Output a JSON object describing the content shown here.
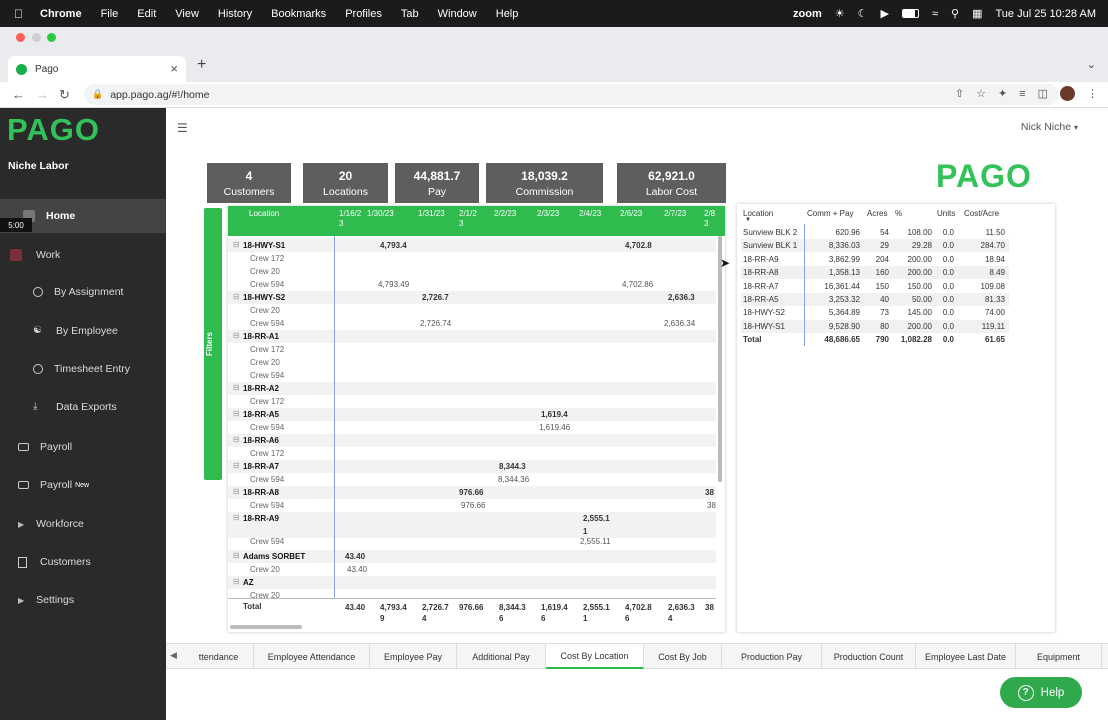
{
  "menubar": {
    "app": "Chrome",
    "items": [
      "File",
      "Edit",
      "View",
      "History",
      "Bookmarks",
      "Profiles",
      "Tab",
      "Window",
      "Help"
    ],
    "zoom": "zoom",
    "datetime": "Tue Jul 25  10:28 AM"
  },
  "browser": {
    "tab_title": "Pago",
    "url": "app.pago.ag/#!/home"
  },
  "sidebar": {
    "logo": "PAGO",
    "org": "Niche Labor",
    "timer": "5:00",
    "items": [
      {
        "label": "Home",
        "active": true
      },
      {
        "label": "Work"
      },
      {
        "label": "By Assignment"
      },
      {
        "label": "By Employee"
      },
      {
        "label": "Timesheet Entry"
      },
      {
        "label": "Data Exports"
      },
      {
        "label": "Payroll"
      },
      {
        "label": "Payroll",
        "badge": "New"
      },
      {
        "label": "Workforce"
      },
      {
        "label": "Customers"
      },
      {
        "label": "Settings"
      }
    ]
  },
  "header": {
    "user": "Nick Niche",
    "brand": "PAGO"
  },
  "kpis": [
    {
      "value": "4",
      "label": "Customers"
    },
    {
      "value": "20",
      "label": "Locations"
    },
    {
      "value": "44,881.7",
      "label": "Pay"
    },
    {
      "value": "18,039.2",
      "label": "Commission"
    },
    {
      "value": "62,921.0",
      "label": "Labor Cost"
    }
  ],
  "filters_label": "Filters",
  "matrix": {
    "columns": [
      "Location",
      "1/16/2\n3",
      "1/30/23",
      "1/31/23",
      "2/1/2\n3",
      "2/2/23",
      "2/3/23",
      "2/4/23",
      "2/6/23",
      "2/7/23",
      "2/8\n3"
    ],
    "rows": [
      {
        "type": "grp",
        "label": "18-HWY-S1",
        "values": {
          "c2": "4,793.4",
          "c8": "4,702.8"
        }
      },
      {
        "type": "sub",
        "label": "Crew 172",
        "values": {}
      },
      {
        "type": "sub",
        "label": "Crew 20",
        "values": {}
      },
      {
        "type": "sub",
        "label": "Crew 594",
        "values": {
          "c2": "4,793.49",
          "c8": "4,702.86"
        }
      },
      {
        "type": "grp",
        "label": "18-HWY-S2",
        "values": {
          "c3": "2,726.7",
          "c9": "2,636.3"
        }
      },
      {
        "type": "sub",
        "label": "Crew 20",
        "values": {}
      },
      {
        "type": "sub",
        "label": "Crew 594",
        "values": {
          "c3": "2,726.74",
          "c9": "2,636.34"
        }
      },
      {
        "type": "grp",
        "label": "18-RR-A1",
        "values": {}
      },
      {
        "type": "sub",
        "label": "Crew 172",
        "values": {}
      },
      {
        "type": "sub",
        "label": "Crew 20",
        "values": {}
      },
      {
        "type": "sub",
        "label": "Crew 594",
        "values": {}
      },
      {
        "type": "grp",
        "label": "18-RR-A2",
        "values": {}
      },
      {
        "type": "sub",
        "label": "Crew 172",
        "values": {}
      },
      {
        "type": "grp",
        "label": "18-RR-A5",
        "values": {
          "c6": "1,619.4"
        }
      },
      {
        "type": "sub",
        "label": "Crew 594",
        "values": {
          "c6": "1,619.46"
        }
      },
      {
        "type": "grp",
        "label": "18-RR-A6",
        "values": {}
      },
      {
        "type": "sub",
        "label": "Crew 172",
        "values": {}
      },
      {
        "type": "grp",
        "label": "18-RR-A7",
        "values": {
          "c5": "8,344.3"
        }
      },
      {
        "type": "sub",
        "label": "Crew 594",
        "values": {
          "c5": "8,344.36"
        }
      },
      {
        "type": "grp",
        "label": "18-RR-A8",
        "values": {
          "c4": "976.66",
          "c10": "38"
        }
      },
      {
        "type": "sub",
        "label": "Crew 594",
        "values": {
          "c4": "976.66",
          "c10": "38"
        }
      },
      {
        "type": "grp",
        "label": "18-RR-A9",
        "values": {
          "c7": "2,555.1"
        }
      },
      {
        "type": "wrap",
        "label": "",
        "values": {
          "c7": "1"
        }
      },
      {
        "type": "sub",
        "label": "Crew 594",
        "values": {
          "c7": "2,555.11"
        }
      },
      {
        "type": "grp",
        "label": "Adams SORBET",
        "values": {
          "c1": "43.40"
        }
      },
      {
        "type": "sub",
        "label": "Crew 20",
        "values": {
          "c1": "43.40"
        }
      },
      {
        "type": "grp",
        "label": "AZ",
        "values": {}
      },
      {
        "type": "sub",
        "label": "Crew 20",
        "values": {}
      }
    ],
    "total_label": "Total",
    "totals": {
      "c1": "43.40",
      "c2": "4,793.4\n9",
      "c3": "2,726.7\n4",
      "c4": "976.66",
      "c5": "8,344.3\n6",
      "c6": "1,619.4\n6",
      "c7": "2,555.1\n1",
      "c8": "4,702.8\n6",
      "c9": "2,636.3\n4",
      "c10": "38"
    }
  },
  "summary": {
    "columns": [
      "Location",
      "Comm + Pay",
      "Acres",
      "%",
      "Units",
      "Cost/Acre"
    ],
    "rows": [
      [
        "Sunview BLK 2",
        "620.96",
        "54",
        "108.00",
        "0.0",
        "11.50"
      ],
      [
        "Sunview BLK 1",
        "8,336.03",
        "29",
        "29.28",
        "0.0",
        "284.70"
      ],
      [
        "18-RR-A9",
        "3,862.99",
        "204",
        "200.00",
        "0.0",
        "18.94"
      ],
      [
        "18-RR-A8",
        "1,358.13",
        "160",
        "200.00",
        "0.0",
        "8.49"
      ],
      [
        "18-RR-A7",
        "16,361.44",
        "150",
        "150.00",
        "0.0",
        "109.08"
      ],
      [
        "18-RR-A5",
        "3,253.32",
        "40",
        "50.00",
        "0.0",
        "81.33"
      ],
      [
        "18-HWY-S2",
        "5,364.89",
        "73",
        "145.00",
        "0.0",
        "74.00"
      ],
      [
        "18-HWY-S1",
        "9,528.90",
        "80",
        "200.00",
        "0.0",
        "119.11"
      ]
    ],
    "total": [
      "Total",
      "48,686.65",
      "790",
      "1,082.28",
      "0.0",
      "61.65"
    ]
  },
  "bottom_tabs": [
    {
      "label": "ttendance"
    },
    {
      "label": "Employee Attendance"
    },
    {
      "label": "Employee Pay"
    },
    {
      "label": "Additional Pay"
    },
    {
      "label": "Cost By Location",
      "active": true
    },
    {
      "label": "Cost By Job"
    },
    {
      "label": "Production Pay"
    },
    {
      "label": "Production Count"
    },
    {
      "label": "Employee Last Date"
    },
    {
      "label": "Equipment"
    }
  ],
  "help_label": "Help",
  "colors": {
    "brand_green": "#33c15a",
    "header_green": "#2fbb4e",
    "sidebar_bg": "#2a2a2a",
    "kpi_bg": "#5e5e5e"
  }
}
